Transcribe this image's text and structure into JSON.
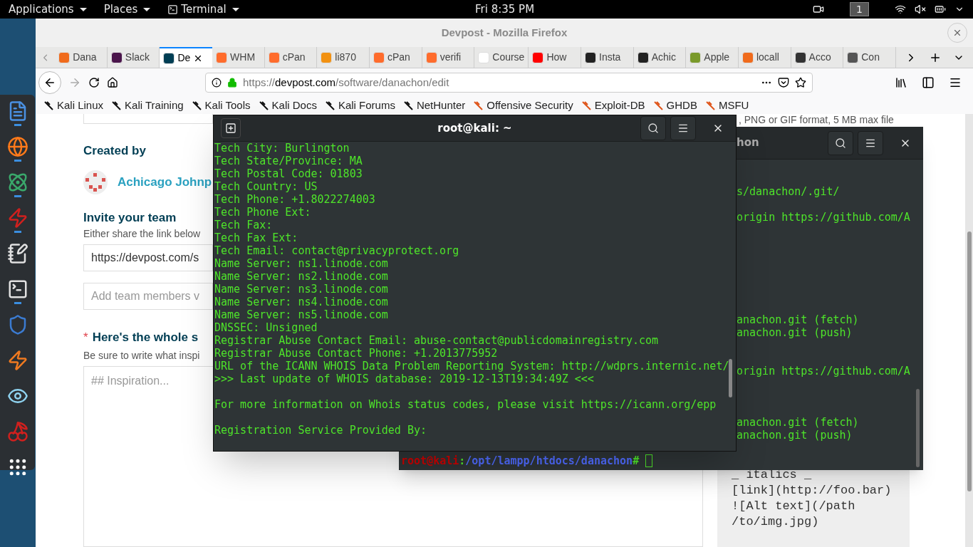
{
  "top_bar": {
    "menus": [
      "Applications",
      "Places",
      "Terminal"
    ],
    "clock": "Fri 8:35 PM",
    "workspace": "1"
  },
  "dock": [
    {
      "running": true
    },
    {
      "running": true
    },
    {
      "running": true
    },
    {
      "running": true
    },
    {
      "running": false
    },
    {
      "running": true
    },
    {
      "running": false
    },
    {
      "running": false
    },
    {
      "running": false
    },
    {
      "running": false
    },
    {
      "running": false
    }
  ],
  "browser": {
    "title": "Devpost - Mozilla Firefox",
    "tabs": [
      {
        "label": "Dana",
        "selected": false
      },
      {
        "label": "Slack",
        "selected": false
      },
      {
        "label": "De",
        "selected": true
      },
      {
        "label": "WHM",
        "selected": false
      },
      {
        "label": "cPan",
        "selected": false
      },
      {
        "label": "li870",
        "selected": false
      },
      {
        "label": "cPan",
        "selected": false
      },
      {
        "label": "verifi",
        "selected": false
      },
      {
        "label": "Course",
        "selected": false
      },
      {
        "label": "How",
        "selected": false
      },
      {
        "label": "Insta",
        "selected": false
      },
      {
        "label": "Achic",
        "selected": false
      },
      {
        "label": "Apple",
        "selected": false
      },
      {
        "label": "locall",
        "selected": false
      },
      {
        "label": "Acco",
        "selected": false
      },
      {
        "label": "Con",
        "selected": false
      }
    ],
    "url": {
      "scheme": "https://",
      "domain": "devpost.com",
      "path": "/software/danachon/edit"
    },
    "bookmarks": [
      "Kali Linux",
      "Kali Training",
      "Kali Tools",
      "Kali Docs",
      "Kali Forums",
      "NetHunter",
      "Offensive Security",
      "Exploit-DB",
      "GHDB",
      "MSFU"
    ],
    "page": {
      "created_by": "Created by",
      "author": "Achicago Johnp",
      "invite_title": "Invite your team",
      "invite_hint": "Either share the link below",
      "share_link": "https://devpost.com/s",
      "add_members": {
        "placeholder": "Add team members v"
      },
      "story_required": "*",
      "story_title": "Here's the whole s",
      "story_hint": "Be sure to write what inspi",
      "story_box": {
        "placeholder": "## Inspiration..."
      },
      "image_hint": ", PNG or GIF format, 5 MB max file",
      "markdown_help": [
        "_ italics _",
        "[link](http://foo.bar)",
        "![Alt text](/path",
        "/to/img.jpg)"
      ]
    }
  },
  "back_terminal": {
    "title": "hon",
    "lines": [
      "s/danachon/.git/",
      "origin https://github.com/A",
      "anachon.git (fetch)",
      "anachon.git (push)",
      "origin https://github.com/A",
      "anachon.git (fetch)",
      "anachon.git (push)"
    ],
    "prompt": {
      "user": "root@kali",
      "separator": ":",
      "path": "/opt/lampp/htdocs/danachon",
      "symbol": "#"
    }
  },
  "front_terminal": {
    "title": "root@kali: ~",
    "blocks": [
      [
        "Tech City: Burlington",
        "Tech State/Province: MA",
        "Tech Postal Code: 01803",
        "Tech Country: US",
        "Tech Phone: +1.8022274003",
        "Tech Phone Ext:",
        "Tech Fax:",
        "Tech Fax Ext:",
        "Tech Email: contact@privacyprotect.org",
        "Name Server: ns1.linode.com",
        "Name Server: ns2.linode.com",
        "Name Server: ns3.linode.com",
        "Name Server: ns4.linode.com",
        "Name Server: ns5.linode.com",
        "DNSSEC: Unsigned",
        "Registrar Abuse Contact Email: abuse-contact@publicdomainregistry.com",
        "Registrar Abuse Contact Phone: +1.2013775952",
        "URL of the ICANN WHOIS Data Problem Reporting System: http://wdprs.internic.net/",
        ">>> Last update of WHOIS database: 2019-12-13T19:34:49Z <<<"
      ],
      [
        "For more information on Whois status codes, please visit https://icann.org/epp"
      ],
      [
        "Registration Service Provided By:"
      ]
    ]
  }
}
